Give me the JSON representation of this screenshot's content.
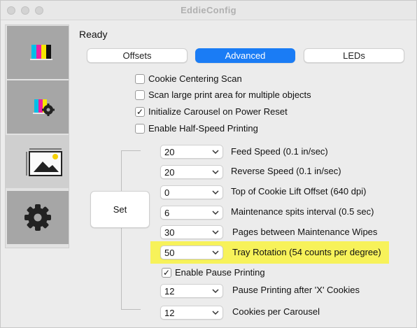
{
  "window": {
    "title": "EddieConfig"
  },
  "sidebar": {
    "items": [
      {
        "name": "color-ink-icon"
      },
      {
        "name": "ink-settings-icon"
      },
      {
        "name": "tray-image-icon"
      },
      {
        "name": "gear-icon"
      }
    ]
  },
  "status": "Ready",
  "tabs": [
    {
      "label": "Offsets",
      "active": false
    },
    {
      "label": "Advanced",
      "active": true
    },
    {
      "label": "LEDs",
      "active": false
    }
  ],
  "checkboxes": [
    {
      "label": "Cookie Centering Scan",
      "checked": false
    },
    {
      "label": "Scan large print area for multiple objects",
      "checked": false
    },
    {
      "label": "Initialize Carousel on Power Reset",
      "checked": true
    },
    {
      "label": "Enable Half-Speed Printing",
      "checked": false
    }
  ],
  "set_button": "Set",
  "check_mark": "✓",
  "settings": [
    {
      "value": "20",
      "label": "Feed Speed (0.1 in/sec)"
    },
    {
      "value": "20",
      "label": "Reverse Speed (0.1 in/sec)"
    },
    {
      "value": "0",
      "label": "Top of Cookie Lift Offset (640 dpi)"
    },
    {
      "value": "6",
      "label": "Maintenance spits interval (0.5 sec)"
    },
    {
      "value": "30",
      "label": "Pages between Maintenance Wipes"
    },
    {
      "value": "50",
      "label": "Tray Rotation (54 counts per degree)",
      "highlighted": true
    }
  ],
  "pause_checkbox": {
    "label": "Enable Pause Printing",
    "checked": true
  },
  "settings_after": [
    {
      "value": "12",
      "label": "Pause Printing after 'X' Cookies"
    },
    {
      "value": "12",
      "label": "Cookies per Carousel"
    }
  ],
  "colors": {
    "accent": "#1a7cf5",
    "highlight": "#f7f25a",
    "sidebar_button": "#a6a6a6"
  }
}
